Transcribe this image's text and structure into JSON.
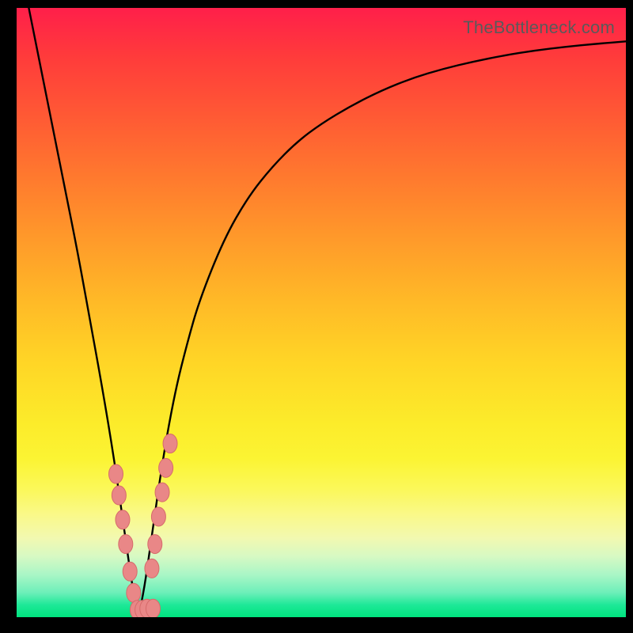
{
  "watermark": "TheBottleneck.com",
  "chart_data": {
    "type": "line",
    "title": "",
    "xlabel": "",
    "ylabel": "",
    "xlim": [
      0,
      100
    ],
    "ylim": [
      0,
      100
    ],
    "notch_x": 20,
    "series": [
      {
        "name": "curve",
        "x": [
          2,
          4,
          6,
          8,
          10,
          12,
          14,
          16,
          18,
          19,
          20,
          21,
          22,
          24,
          26,
          28,
          30,
          34,
          38,
          42,
          46,
          50,
          55,
          60,
          65,
          70,
          75,
          80,
          85,
          90,
          95,
          100
        ],
        "values": [
          100,
          90,
          80,
          70,
          60,
          49,
          38,
          26,
          12,
          5,
          0,
          5,
          12,
          26,
          37,
          45,
          52,
          62,
          69,
          74,
          78,
          81,
          84,
          86.5,
          88.5,
          90,
          91.2,
          92.2,
          93,
          93.6,
          94.1,
          94.5
        ]
      }
    ],
    "dots": [
      {
        "x": 16.8,
        "y": 20.0
      },
      {
        "x": 16.3,
        "y": 23.5
      },
      {
        "x": 17.4,
        "y": 16.0
      },
      {
        "x": 17.9,
        "y": 12.0
      },
      {
        "x": 18.6,
        "y": 7.5
      },
      {
        "x": 19.2,
        "y": 4.0
      },
      {
        "x": 19.8,
        "y": 1.2
      },
      {
        "x": 20.6,
        "y": 1.2
      },
      {
        "x": 21.4,
        "y": 1.4
      },
      {
        "x": 22.4,
        "y": 1.4
      },
      {
        "x": 22.2,
        "y": 8.0
      },
      {
        "x": 22.7,
        "y": 12.0
      },
      {
        "x": 23.3,
        "y": 16.5
      },
      {
        "x": 23.9,
        "y": 20.5
      },
      {
        "x": 24.5,
        "y": 24.5
      },
      {
        "x": 25.2,
        "y": 28.5
      }
    ],
    "colors": {
      "curve": "#000000",
      "dot_fill": "#e98787",
      "dot_stroke": "#d66b6b"
    }
  }
}
